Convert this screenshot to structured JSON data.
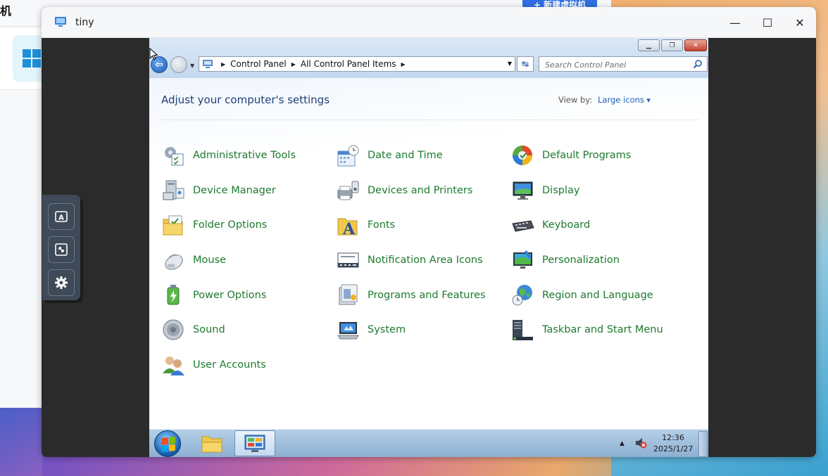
{
  "host": {
    "title": "机",
    "new_vm_button": "+ 新建虚拟机"
  },
  "float_toolbar": {
    "items": [
      "keyboard-icon",
      "fullscreen-icon",
      "settings-icon"
    ]
  },
  "vm_window": {
    "title": "tiny",
    "controls": {
      "minimize": "—",
      "maximize": "☐",
      "close": "✕"
    }
  },
  "explorer": {
    "breadcrumb": [
      "Control Panel",
      "All Control Panel Items"
    ],
    "search_placeholder": "Search Control Panel",
    "heading": "Adjust your computer's settings",
    "view_by_label": "View by:",
    "view_by_value": "Large icons",
    "items": [
      {
        "label": "Administrative Tools",
        "icon": "admin-tools-icon"
      },
      {
        "label": "Date and Time",
        "icon": "date-time-icon"
      },
      {
        "label": "Default Programs",
        "icon": "default-programs-icon"
      },
      {
        "label": "Device Manager",
        "icon": "device-manager-icon"
      },
      {
        "label": "Devices and Printers",
        "icon": "devices-printers-icon"
      },
      {
        "label": "Display",
        "icon": "display-icon"
      },
      {
        "label": "Folder Options",
        "icon": "folder-options-icon"
      },
      {
        "label": "Fonts",
        "icon": "fonts-icon"
      },
      {
        "label": "Keyboard",
        "icon": "keyboard-icon"
      },
      {
        "label": "Mouse",
        "icon": "mouse-icon"
      },
      {
        "label": "Notification Area Icons",
        "icon": "notification-area-icon"
      },
      {
        "label": "Personalization",
        "icon": "personalization-icon"
      },
      {
        "label": "Power Options",
        "icon": "power-options-icon"
      },
      {
        "label": "Programs and Features",
        "icon": "programs-features-icon"
      },
      {
        "label": "Region and Language",
        "icon": "region-language-icon"
      },
      {
        "label": "Sound",
        "icon": "sound-icon"
      },
      {
        "label": "System",
        "icon": "system-icon"
      },
      {
        "label": "Taskbar and Start Menu",
        "icon": "taskbar-start-icon"
      },
      {
        "label": "User Accounts",
        "icon": "user-accounts-icon"
      }
    ]
  },
  "taskbar": {
    "time": "12:36",
    "date": "2025/1/27"
  },
  "colors": {
    "link_green": "#1d7a2e",
    "heading_blue": "#1e3f78",
    "viewby_blue": "#1e5fba"
  }
}
